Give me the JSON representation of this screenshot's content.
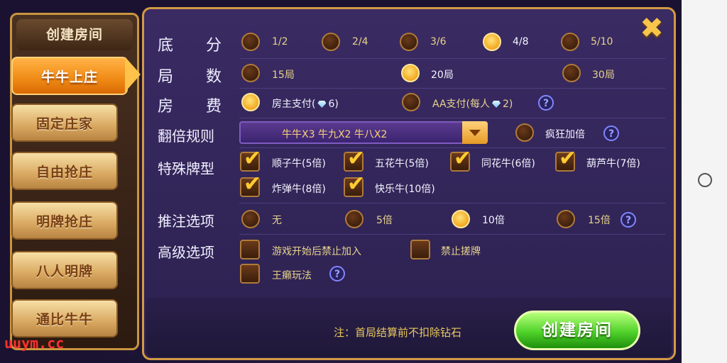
{
  "sidebar": {
    "title": "创建房间",
    "items": [
      {
        "label": "牛牛上庄",
        "active": true
      },
      {
        "label": "固定庄家",
        "active": false
      },
      {
        "label": "自由抢庄",
        "active": false
      },
      {
        "label": "明牌抢庄",
        "active": false
      },
      {
        "label": "八人明牌",
        "active": false
      },
      {
        "label": "通比牛牛",
        "active": false
      }
    ]
  },
  "close_icon": "close-icon",
  "rows": {
    "base_score": {
      "label1": "底",
      "label2": "分",
      "options": [
        "1/2",
        "2/4",
        "3/6",
        "4/8",
        "5/10"
      ],
      "selected": "4/8"
    },
    "rounds": {
      "label1": "局",
      "label2": "数",
      "options": [
        "15局",
        "20局",
        "30局"
      ],
      "selected": "20局"
    },
    "room_fee": {
      "label1": "房",
      "label2": "费",
      "option1_prefix": "房主支付(",
      "option1_suffix": "6)",
      "option2_prefix": "AA支付(每人",
      "option2_suffix": "2)",
      "selected": "房主支付"
    },
    "multiplier": {
      "label": "翻倍规则",
      "dropdown_value": "牛牛X3  牛九X2  牛八X2",
      "crazy_label": "疯狂加倍",
      "crazy_checked": false
    },
    "special": {
      "label": "特殊牌型",
      "options": [
        "顺子牛(5倍)",
        "五花牛(5倍)",
        "同花牛(6倍)",
        "葫芦牛(7倍)",
        "炸弹牛(8倍)",
        "快乐牛(10倍)"
      ],
      "checked": [
        true,
        true,
        true,
        true,
        true,
        true
      ]
    },
    "push": {
      "label": "推注选项",
      "options": [
        "无",
        "5倍",
        "10倍",
        "15倍"
      ],
      "selected": "10倍"
    },
    "advanced": {
      "label": "高级选项",
      "options": [
        "游戏开始后禁止加入",
        "禁止搓牌",
        "王癞玩法"
      ],
      "checked": [
        false,
        false,
        false
      ]
    }
  },
  "help_symbol": "?",
  "footer": {
    "note": "注：首局结算前不扣除钻石",
    "create_button": "创建房间"
  },
  "watermark": "uuym.cc",
  "colors": {
    "accent": "#f08a15",
    "panel": "#3a2b63",
    "green_button": "#4fd22a",
    "option_text": "#e7d48c"
  }
}
